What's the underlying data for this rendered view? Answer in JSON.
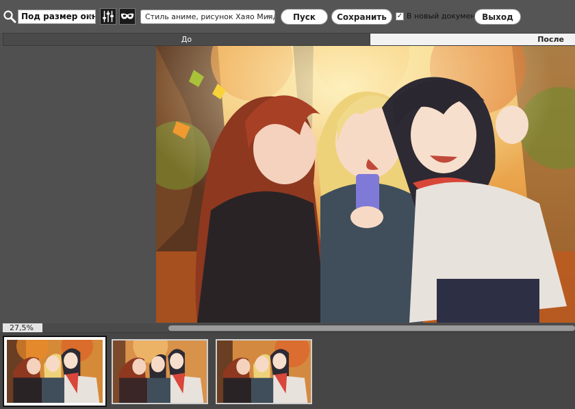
{
  "toolbar": {
    "zoom_icon": "magnifier-icon",
    "size_select_value": "Под размер окна",
    "settings_icon": "sliders-icon",
    "mask_icon": "mask-icon",
    "style_select_value": "Стиль аниме, рисунок Хаяо Миядз",
    "run_label": "Пуск",
    "save_label": "Сохранить",
    "new_document_checked": true,
    "new_document_label": "В новый документ",
    "exit_label": "Выход"
  },
  "compare": {
    "before_label": "До",
    "after_label": "После"
  },
  "viewer": {
    "zoom_level": "27,5%",
    "image_description_icon": "anime-photo-image"
  },
  "thumbnails": [
    {
      "name": "thumbnail-1",
      "selected": true
    },
    {
      "name": "thumbnail-2",
      "selected": false
    },
    {
      "name": "thumbnail-3",
      "selected": false
    }
  ],
  "colors": {
    "background": "#505050",
    "toolbar": "#555555",
    "button_bg": "#ffffff",
    "after_tab_bg": "#f2f2f2",
    "before_tab_bg": "#4a4a4a"
  }
}
